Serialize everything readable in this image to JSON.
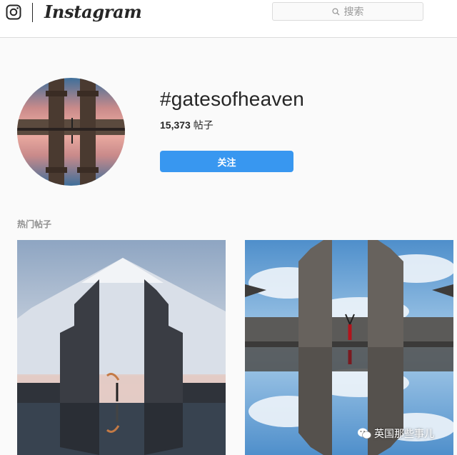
{
  "header": {
    "app_name": "Instagram",
    "search_placeholder": "搜索",
    "logo_icon": "instagram-camera-icon",
    "search_icon": "search-icon"
  },
  "profile": {
    "hashtag": "#gatesofheaven",
    "post_count": "15,373",
    "post_count_label": "帖子",
    "follow_label": "关注"
  },
  "posts_section": {
    "title": "热门帖子",
    "items": [
      {
        "name": "temple-gate-mountain-photo"
      },
      {
        "name": "temple-gate-clouds-photo"
      }
    ]
  },
  "watermark": {
    "text": "英国那些事儿",
    "icon": "wechat-icon"
  },
  "colors": {
    "follow_button": "#3897f0",
    "background": "#fafafa",
    "text": "#262626",
    "muted": "#8e8e8e"
  }
}
